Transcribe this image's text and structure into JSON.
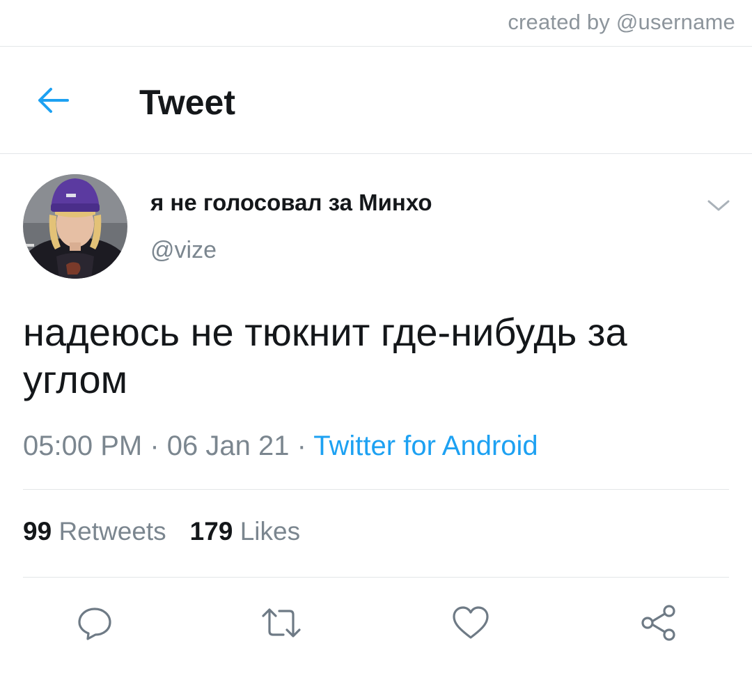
{
  "credit": "created by @username",
  "header": {
    "title": "Tweet",
    "back_icon": "arrow-left-icon"
  },
  "tweet": {
    "display_name": "я не голосовал за Минхо",
    "handle": "@vize",
    "text": "надеюсь не тюкнит где-нибудь за углом",
    "time": "05:00 PM",
    "date": "06 Jan 21",
    "source": "Twitter for Android",
    "separator": " · "
  },
  "stats": {
    "retweets_count": "99",
    "retweets_label": "Retweets",
    "likes_count": "179",
    "likes_label": "Likes"
  },
  "actions": [
    "reply-icon",
    "retweet-icon",
    "like-icon",
    "share-icon"
  ],
  "colors": {
    "accent": "#1da1f2",
    "text_primary": "#14171a",
    "text_secondary": "#7b868f",
    "divider": "#e3e6e8"
  }
}
